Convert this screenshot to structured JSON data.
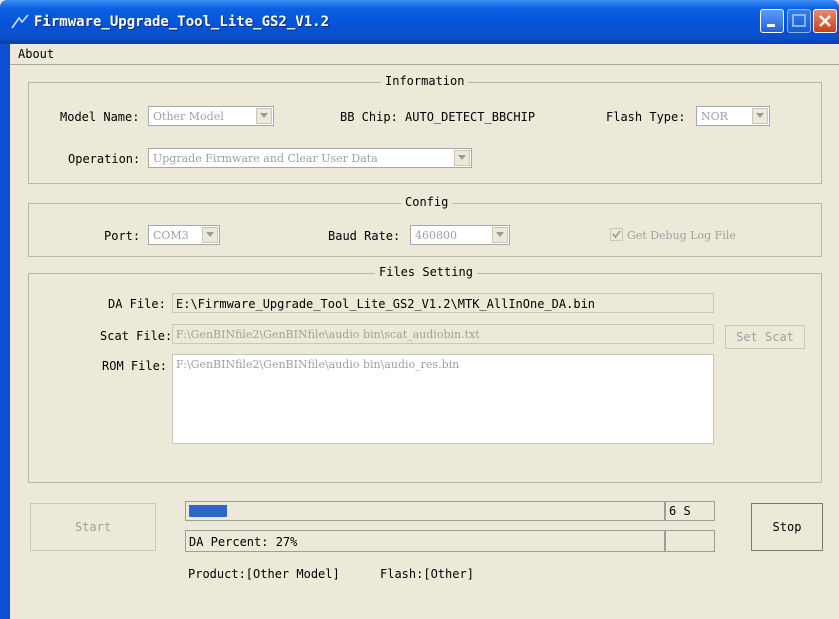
{
  "window": {
    "title": "Firmware_Upgrade_Tool_Lite_GS2_V1.2"
  },
  "menu": {
    "about": "About"
  },
  "information": {
    "title": "Information",
    "model_name_label": "Model Name:",
    "model_name_value": "Other Model",
    "bb_chip": "BB Chip: AUTO_DETECT_BBCHIP",
    "flash_type_label": "Flash Type:",
    "flash_type_value": "NOR",
    "operation_label": "Operation:",
    "operation_value": "Upgrade Firmware and Clear User Data"
  },
  "config": {
    "title": "Config",
    "port_label": "Port:",
    "port_value": "COM3",
    "baud_label": "Baud Rate:",
    "baud_value": "460800",
    "debug_log_label": "Get Debug Log File",
    "debug_log_checked": true
  },
  "files": {
    "title": "Files Setting",
    "da_label": "DA File:",
    "da_value": "E:\\Firmware_Upgrade_Tool_Lite_GS2_V1.2\\MTK_AllInOne_DA.bin",
    "scat_label": "Scat File:",
    "scat_value": "F:\\GenBINfile2\\GenBINfile\\audio bin\\scat_audiobin.txt",
    "set_scat": "Set Scat",
    "rom_label": "ROM File:",
    "rom_value": "F:\\GenBINfile2\\GenBINfile\\audio bin\\audio_res.bin"
  },
  "bottom": {
    "start": "Start",
    "stop": "Stop",
    "elapsed": "6 S",
    "progress_fraction": 0.08,
    "status": "DA Percent: 27%",
    "product": "Product:[Other Model]",
    "flash": "Flash:[Other]"
  }
}
